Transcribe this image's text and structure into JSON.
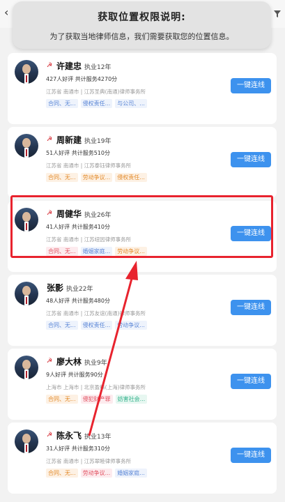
{
  "header": {
    "back_icon": "chevron-left-icon",
    "filter_icon": "filter-icon"
  },
  "permission_dialog": {
    "title": "获取位置权限说明:",
    "description": "为了获取当地律师信息，我们需要获取您的位置信息。"
  },
  "lawyers": [
    {
      "name": "许建忠",
      "years": "执业12年",
      "stats": "427人好评  共计服务4270分",
      "location": "江苏省  南通市 | 江苏圣典(南通)律师事务所",
      "tags": [
        {
          "text": "合同、无...",
          "color": "blue"
        },
        {
          "text": "侵权责任...",
          "color": "blue"
        },
        {
          "text": "与公司、...",
          "color": "blue"
        }
      ],
      "button": "一键连线"
    },
    {
      "name": "周新建",
      "years": "执业19年",
      "stats": "51人好评  共计服务510分",
      "location": "江苏省  南通市 | 江苏泰钰律师事务所",
      "tags": [
        {
          "text": "合同、无...",
          "color": "orange"
        },
        {
          "text": "劳动争议...",
          "color": "orange"
        },
        {
          "text": "侵权责任...",
          "color": "orange"
        }
      ],
      "button": "一键连线"
    },
    {
      "name": "周健华",
      "years": "执业26年",
      "stats": "41人好评  共计服务410分",
      "location": "江苏省  南通市 | 江苏纽因律师事务所",
      "tags": [
        {
          "text": "合同、无...",
          "color": "red"
        },
        {
          "text": "婚姻家庭...",
          "color": "blue"
        },
        {
          "text": "劳动争议...",
          "color": "orange"
        }
      ],
      "button": "一键连线"
    },
    {
      "name": "张影",
      "years": "执业22年",
      "stats": "48人好评  共计服务480分",
      "location": "江苏省  南通市 | 江苏友谊(南通)律师事务所",
      "tags": [
        {
          "text": "合同、无...",
          "color": "blue"
        },
        {
          "text": "侵权责任...",
          "color": "blue"
        },
        {
          "text": "劳动争议...",
          "color": "blue"
        }
      ],
      "button": "一键连线"
    },
    {
      "name": "廖大林",
      "years": "执业9年",
      "stats": "9人好评  共计服务90分",
      "location": "上海市  上海市 | 北京盈科(上海)律师事务所",
      "tags": [
        {
          "text": "合同、无...",
          "color": "orange"
        },
        {
          "text": "侵犯财产罪",
          "color": "red"
        },
        {
          "text": "妨害社会...",
          "color": "green"
        }
      ],
      "button": "一键连线"
    },
    {
      "name": "陈永飞",
      "years": "执业13年",
      "stats": "31人好评  共计服务310分",
      "location": "江苏省  南通市 | 江苏翠睦律师事务所",
      "tags": [
        {
          "text": "合同、无...",
          "color": "orange"
        },
        {
          "text": "劳动争议...",
          "color": "red"
        },
        {
          "text": "婚姻家庭...",
          "color": "blue"
        }
      ],
      "button": "一键连线"
    }
  ]
}
